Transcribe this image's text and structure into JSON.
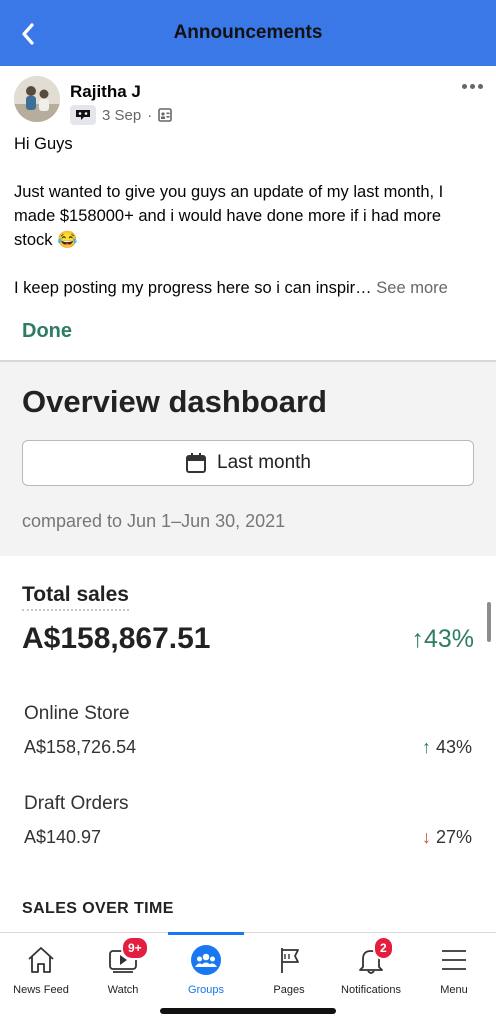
{
  "header": {
    "title": "Announcements",
    "back_icon": "chevron-left-icon",
    "bg_color": "#3b78e7"
  },
  "post": {
    "author": "Rajitha J",
    "date": "3 Sep",
    "dot": "·",
    "badge_icon": "group-member-badge-icon",
    "audience_icon": "group-audience-icon",
    "paragraphs": [
      "Hi Guys",
      "Just wanted to give you guys an update of my last month, I made $158000+ and i would have done more if i had more stock 😂",
      "I keep posting my progress here so i can inspir…"
    ],
    "see_more": "See more"
  },
  "dashboard": {
    "done_label": "Done",
    "title": "Overview dashboard",
    "period_label": "Last month",
    "period_icon": "calendar-icon",
    "compared_text": "compared to Jun 1–Jun 30, 2021",
    "total_sales": {
      "label": "Total sales",
      "value": "A$158,867.51",
      "change": "43%",
      "direction": "up"
    },
    "channels": [
      {
        "label": "Online Store",
        "value": "A$158,726.54",
        "change": "43%",
        "direction": "up"
      },
      {
        "label": "Draft Orders",
        "value": "A$140.97",
        "change": "27%",
        "direction": "down"
      }
    ],
    "sales_over_time_label": "SALES OVER TIME",
    "accent_color": "#2f7b65",
    "down_color": "#d0473c"
  },
  "tabs": [
    {
      "label": "News Feed",
      "icon": "home-icon",
      "active": false,
      "badge": null
    },
    {
      "label": "Watch",
      "icon": "video-icon",
      "active": false,
      "badge": "9+"
    },
    {
      "label": "Groups",
      "icon": "groups-icon",
      "active": true,
      "badge": null
    },
    {
      "label": "Pages",
      "icon": "flag-icon",
      "active": false,
      "badge": null
    },
    {
      "label": "Notifications",
      "icon": "bell-icon",
      "active": false,
      "badge": "2"
    },
    {
      "label": "Menu",
      "icon": "hamburger-menu-icon",
      "active": false,
      "badge": null
    }
  ]
}
